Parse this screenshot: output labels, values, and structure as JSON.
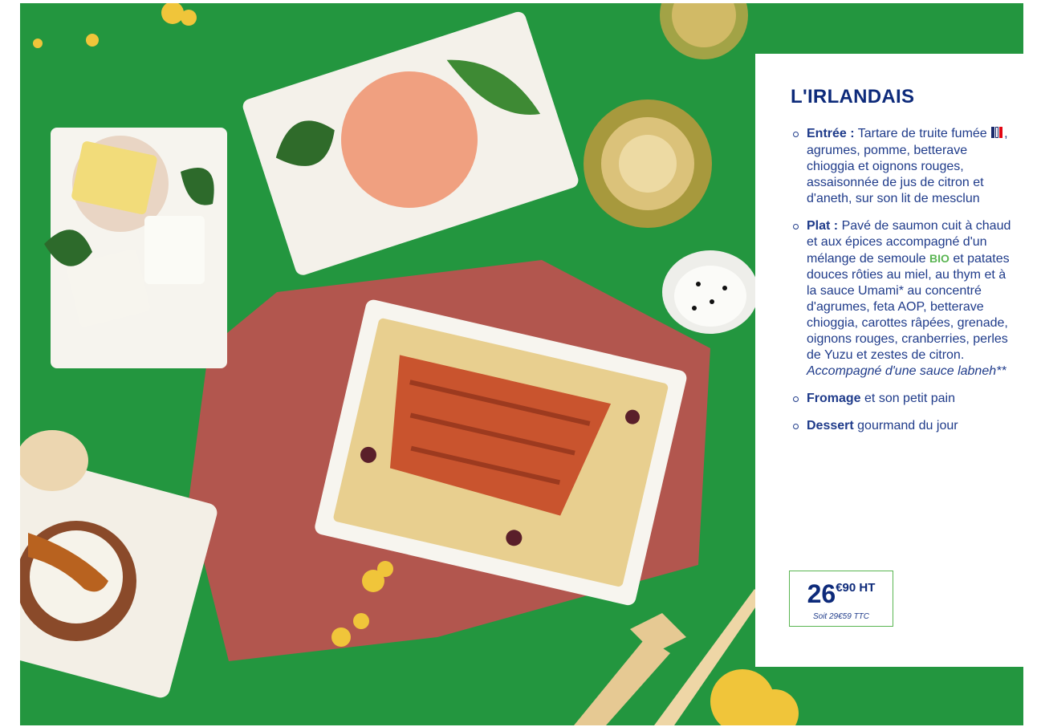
{
  "menu": {
    "title": "L'IRLANDAIS",
    "courses": [
      {
        "name": "Entrée :",
        "text_before": " Tartare de truite fumée ",
        "text_after": ", agrumes, pomme, betterave chioggia et oignons rouges, assaisonnée de jus de citron et d'aneth, sur son lit de mesclun"
      },
      {
        "name": "Plat :",
        "text_before": " Pavé de saumon cuit à chaud et aux épices accompagné d'un mélange de semoule ",
        "badge": "BIO",
        "text_after": " et patates douces rôties au miel, au thym et à la sauce Umami* au concentré d'agrumes, feta AOP, betterave chioggia, carottes râpées, grenade, oignons rouges, cranberries, perles de Yuzu et zestes de citron. ",
        "italic": "Accompagné d'une sauce labneh**"
      },
      {
        "name": "Fromage",
        "text": " et son petit pain"
      },
      {
        "name": "Dessert",
        "text": " gourmand du jour"
      }
    ],
    "price": {
      "integer": "26",
      "decimal": "€90 HT",
      "ttc": "Soit 29€59 TTC"
    }
  },
  "colors": {
    "background_green": "#23963f",
    "title_navy": "#0d2a7a",
    "text_blue": "#1f3b8a",
    "bio_green": "#5ab552",
    "price_border": "#5ab552",
    "flag_colors": [
      "#1a2a6c",
      "#ffffff",
      "#e30613"
    ]
  }
}
